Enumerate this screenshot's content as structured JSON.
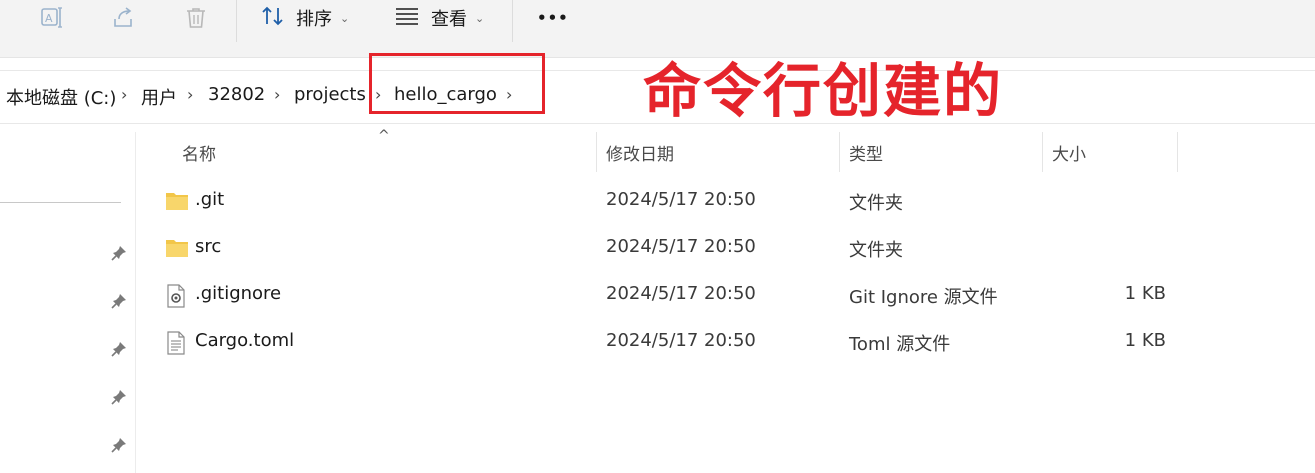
{
  "toolbar": {
    "rename_icon": "rename-icon",
    "share_icon": "share-icon",
    "delete_icon": "delete-icon",
    "sort_label": "排序",
    "view_label": "查看",
    "more_label": "•••"
  },
  "address": {
    "crumbs": [
      "本地磁盘 (C:)",
      "用户",
      "32802",
      "projects",
      "hello_cargo"
    ]
  },
  "annotation": {
    "text": "命令行创建的",
    "color": "#e5242b"
  },
  "columns": {
    "name": "名称",
    "modified": "修改日期",
    "type": "类型",
    "size": "大小"
  },
  "files": [
    {
      "name": ".git",
      "modified": "2024/5/17 20:50",
      "type": "文件夹",
      "size": "",
      "icon": "folder-icon"
    },
    {
      "name": "src",
      "modified": "2024/5/17 20:50",
      "type": "文件夹",
      "size": "",
      "icon": "folder-icon"
    },
    {
      "name": ".gitignore",
      "modified": "2024/5/17 20:50",
      "type": "Git Ignore 源文件",
      "size": "1 KB",
      "icon": "settings-file-icon"
    },
    {
      "name": "Cargo.toml",
      "modified": "2024/5/17 20:50",
      "type": "Toml 源文件",
      "size": "1 KB",
      "icon": "text-file-icon"
    }
  ]
}
